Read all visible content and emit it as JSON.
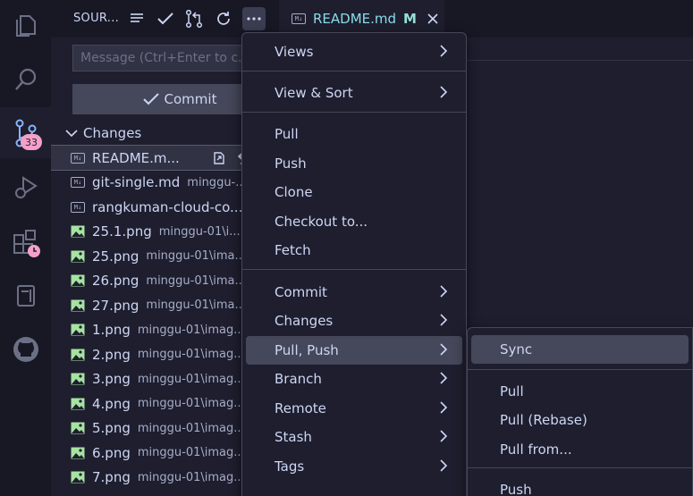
{
  "activity_bar": {
    "items": [
      "explorer",
      "search",
      "source-control",
      "run-debug",
      "extensions",
      "notebook",
      "github"
    ],
    "badge": "33"
  },
  "sidebar": {
    "title": "SOUR...",
    "message_placeholder": "Message (Ctrl+Enter to c...",
    "commit_label": "Commit",
    "changes_label": "Changes",
    "files": [
      {
        "name": "README.m...",
        "path": "",
        "icon": "markdown"
      },
      {
        "name": "git-single.md",
        "path": "minggu-...",
        "icon": "markdown"
      },
      {
        "name": "rangkuman-cloud-co...",
        "path": "",
        "icon": "markdown"
      },
      {
        "name": "25.1.png",
        "path": "minggu-01\\i...",
        "icon": "image"
      },
      {
        "name": "25.png",
        "path": "minggu-01\\ima...",
        "icon": "image"
      },
      {
        "name": "26.png",
        "path": "minggu-01\\ima...",
        "icon": "image"
      },
      {
        "name": "27.png",
        "path": "minggu-01\\ima...",
        "icon": "image"
      },
      {
        "name": "1.png",
        "path": "minggu-01\\imag...",
        "icon": "image"
      },
      {
        "name": "2.png",
        "path": "minggu-01\\imag...",
        "icon": "image"
      },
      {
        "name": "3.png",
        "path": "minggu-01\\imag...",
        "icon": "image"
      },
      {
        "name": "4.png",
        "path": "minggu-01\\imag...",
        "icon": "image"
      },
      {
        "name": "5.png",
        "path": "minggu-01\\imag...",
        "icon": "image"
      },
      {
        "name": "6.png",
        "path": "minggu-01\\imag...",
        "icon": "image"
      },
      {
        "name": "7.png",
        "path": "minggu-01\\imag...",
        "icon": "image"
      }
    ]
  },
  "tab": {
    "name": "README.md",
    "status": "M"
  },
  "menu": {
    "items": [
      {
        "label": "Views",
        "submenu": true
      },
      {
        "label": "View & Sort",
        "submenu": true
      },
      {
        "label": "Pull",
        "submenu": false
      },
      {
        "label": "Push",
        "submenu": false
      },
      {
        "label": "Clone",
        "submenu": false
      },
      {
        "label": "Checkout to...",
        "submenu": false
      },
      {
        "label": "Fetch",
        "submenu": false
      },
      {
        "label": "Commit",
        "submenu": true
      },
      {
        "label": "Changes",
        "submenu": true
      },
      {
        "label": "Pull, Push",
        "submenu": true
      },
      {
        "label": "Branch",
        "submenu": true
      },
      {
        "label": "Remote",
        "submenu": true
      },
      {
        "label": "Stash",
        "submenu": true
      },
      {
        "label": "Tags",
        "submenu": true
      }
    ]
  },
  "submenu": {
    "items": [
      {
        "label": "Sync"
      },
      {
        "label": "Pull"
      },
      {
        "label": "Pull (Rebase)"
      },
      {
        "label": "Pull from..."
      },
      {
        "label": "Push"
      }
    ]
  },
  "colors": {
    "accent": "#89b4fa",
    "badge": "#f5a0c8",
    "image_icon": "#a6e3a1",
    "tab_name": "#89dceb",
    "modified": "#94e2d5"
  }
}
